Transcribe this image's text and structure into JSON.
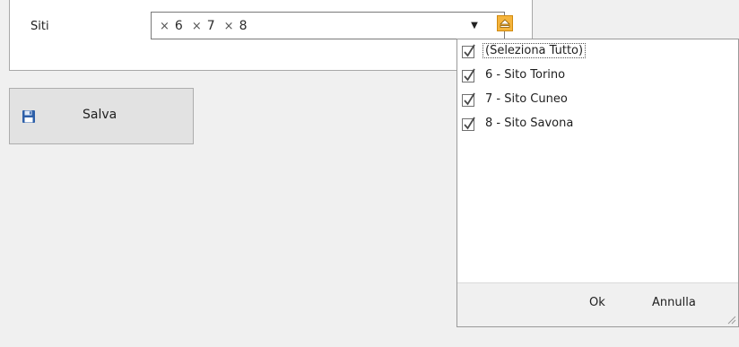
{
  "form": {
    "sites_label": "Siti",
    "tokens": [
      {
        "remove_glyph": "×",
        "value": "6"
      },
      {
        "remove_glyph": "×",
        "value": "7"
      },
      {
        "remove_glyph": "×",
        "value": "8"
      }
    ],
    "dropdown_glyph": "▼",
    "clear_icon": "eject-icon"
  },
  "save_button": {
    "label": "Salva",
    "icon": "floppy-disk-icon"
  },
  "popup": {
    "items": [
      {
        "label": "(Seleziona Tutto)",
        "checked": true
      },
      {
        "label": "6 - Sito Torino",
        "checked": true
      },
      {
        "label": "7 - Sito Cuneo",
        "checked": true
      },
      {
        "label": "8 - Sito Savona",
        "checked": true
      }
    ],
    "ok_label": "Ok",
    "cancel_label": "Annulla"
  },
  "colors": {
    "clear_button": "#f5b43c",
    "save_icon": "#2d5fa8",
    "background": "#f0f0f0"
  }
}
